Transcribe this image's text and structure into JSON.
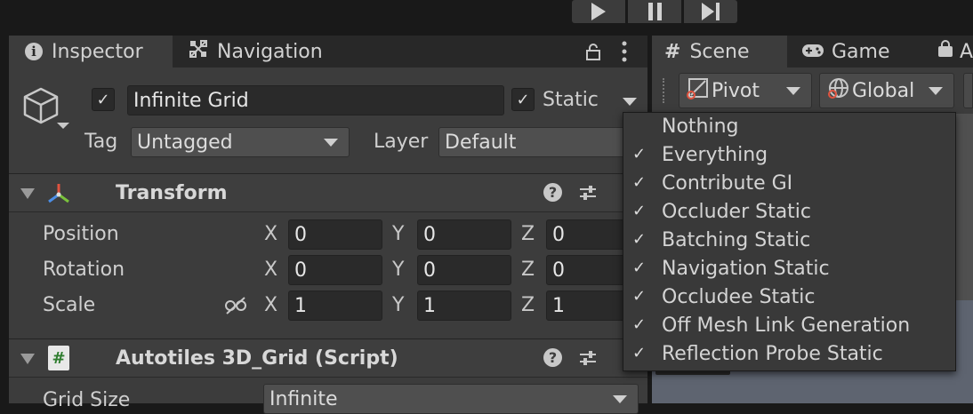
{
  "toolbar": {
    "play_icon": "play-icon",
    "pause_icon": "pause-icon",
    "step_icon": "step-icon"
  },
  "inspector_tabs": [
    {
      "label": "Inspector",
      "icon": "info-icon"
    },
    {
      "label": "Navigation",
      "icon": "navigation-icon"
    }
  ],
  "scene_tabs": [
    {
      "label": "Scene",
      "icon": "hash-icon"
    },
    {
      "label": "Game",
      "icon": "gamepad-icon"
    },
    {
      "label": "A",
      "icon": "bag-icon"
    }
  ],
  "gameobject": {
    "name": "Infinite Grid",
    "static_label": "Static",
    "tag_label": "Tag",
    "tag_value": "Untagged",
    "layer_label": "Layer",
    "layer_value": "Default"
  },
  "transform": {
    "title": "Transform",
    "rows": [
      {
        "label": "Position",
        "x": "0",
        "y": "0",
        "z": "0"
      },
      {
        "label": "Rotation",
        "x": "0",
        "y": "0",
        "z": "0"
      },
      {
        "label": "Scale",
        "x": "1",
        "y": "1",
        "z": "1"
      }
    ],
    "axes": {
      "x": "X",
      "y": "Y",
      "z": "Z"
    }
  },
  "script_component": {
    "title": "Autotiles 3D_Grid (Script)",
    "field_label": "Grid Size",
    "field_value": "Infinite"
  },
  "scene_toolbar": {
    "pivot": "Pivot",
    "global": "Global"
  },
  "static_menu": {
    "items": [
      {
        "label": "Nothing",
        "checked": false
      },
      {
        "label": "Everything",
        "checked": true
      },
      {
        "label": "Contribute GI",
        "checked": true
      },
      {
        "label": "Occluder Static",
        "checked": true
      },
      {
        "label": "Batching Static",
        "checked": true
      },
      {
        "label": "Navigation Static",
        "checked": true
      },
      {
        "label": "Occludee Static",
        "checked": true
      },
      {
        "label": "Off Mesh Link Generation",
        "checked": true
      },
      {
        "label": "Reflection Probe Static",
        "checked": true
      }
    ],
    "check_glyph": "✓"
  },
  "colors": {
    "panel_bg": "#3c3c3c",
    "field_bg": "#2a2a2a",
    "menu_bg": "#393939",
    "transform_icon_red": "#e0533f",
    "transform_icon_green": "#7ac23c",
    "transform_icon_blue": "#4c8ee6",
    "script_icon_green": "#3d8a3d"
  }
}
